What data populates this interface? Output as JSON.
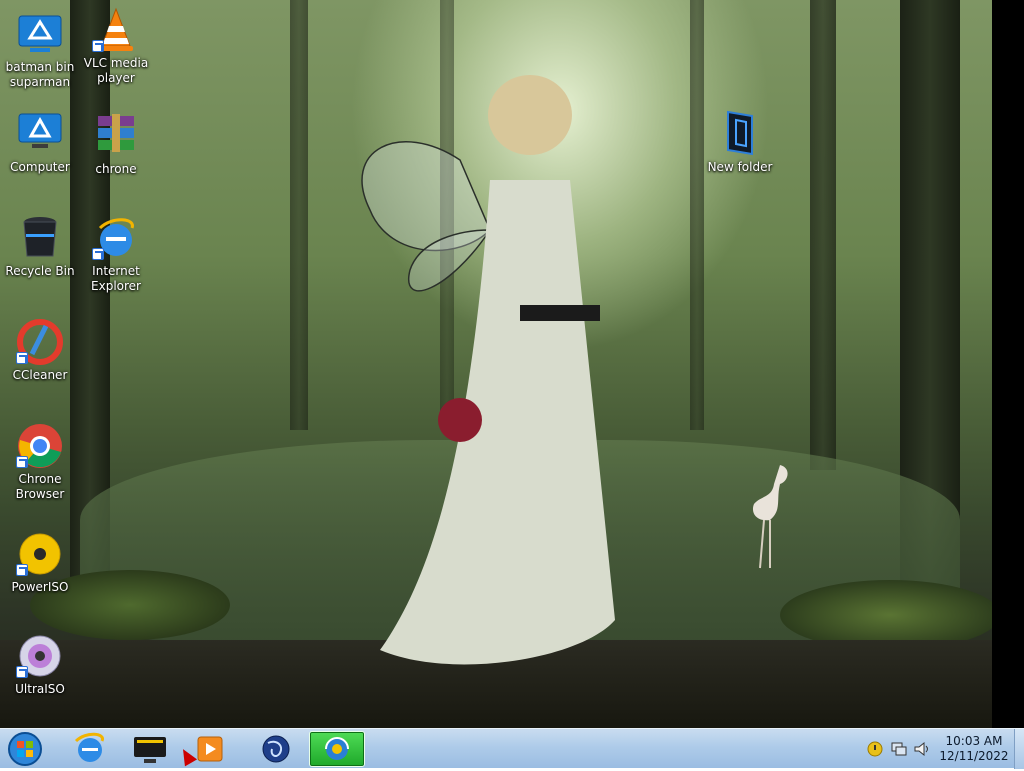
{
  "desktop": {
    "icons": [
      {
        "label": "batman bin suparman",
        "icon": "network-folder-icon"
      },
      {
        "label": "VLC media player",
        "icon": "vlc-icon"
      },
      {
        "label": "Computer",
        "icon": "computer-icon"
      },
      {
        "label": "chrone",
        "icon": "winrar-archive-icon"
      },
      {
        "label": "New folder",
        "icon": "folder-icon"
      },
      {
        "label": "Recycle Bin",
        "icon": "recycle-bin-icon"
      },
      {
        "label": "Internet Explorer",
        "icon": "internet-explorer-icon"
      },
      {
        "label": "CCleaner",
        "icon": "ccleaner-icon"
      },
      {
        "label": "Chrone Browser",
        "icon": "chrome-icon"
      },
      {
        "label": "PowerISO",
        "icon": "poweriso-icon"
      },
      {
        "label": "UltraISO",
        "icon": "ultraiso-icon"
      }
    ]
  },
  "taskbar": {
    "pinned": [
      {
        "name": "Internet Explorer",
        "icon": "internet-explorer-icon"
      },
      {
        "name": "Media Center",
        "icon": "media-center-icon"
      },
      {
        "name": "Media Player",
        "icon": "media-player-icon"
      },
      {
        "name": "Network",
        "icon": "network-globe-icon"
      },
      {
        "name": "Browser",
        "icon": "browser-icon",
        "active": true
      }
    ],
    "clock": {
      "time": "10:03 AM",
      "date": "12/11/2022"
    }
  },
  "colors": {
    "taskbar": "#aecbe9",
    "active_item": "#2fbf3a",
    "label_text": "#ffffff"
  }
}
